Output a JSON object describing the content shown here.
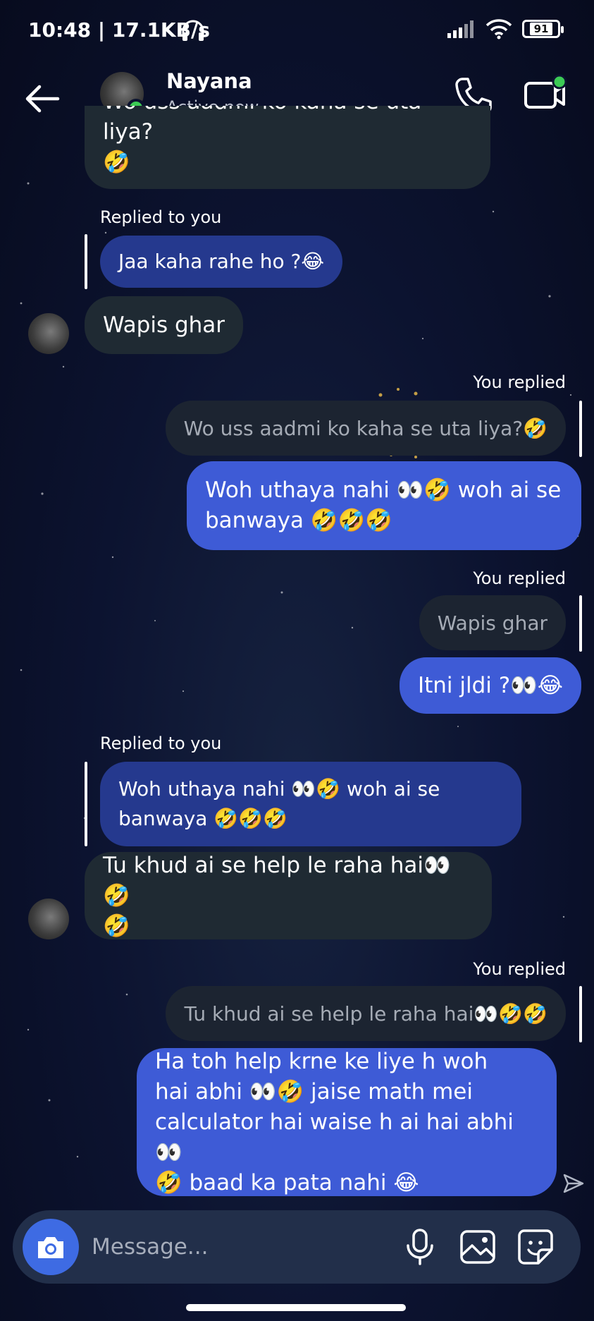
{
  "status_bar": {
    "time": "10:48 | 17.1KB/s",
    "battery": "91",
    "icons": [
      "headphones-icon",
      "signal-icon",
      "wifi-icon",
      "battery-icon"
    ]
  },
  "header": {
    "contact_name": "Nayana",
    "contact_status": "Active now",
    "online_color": "#3ccb55",
    "icons": [
      "back-arrow-icon",
      "phone-icon",
      "video-call-icon"
    ]
  },
  "messages": {
    "m0_line1": "Wo uss aadmi ko kaha se uta liya?",
    "m0_line2": "🤣",
    "m1_label": "Replied to you",
    "m1_quote": "Jaa kaha rahe ho ?😂",
    "m2_text": "Wapis ghar",
    "m3_label": "You replied",
    "m3_quote": "Wo uss aadmi ko kaha se uta liya?🤣",
    "m4_line1": "Woh uthaya nahi 👀🤣 woh ai se",
    "m4_line2": "banwaya 🤣🤣🤣",
    "m5_label": "You replied",
    "m5_quote": "Wapis ghar",
    "m6_text": "Itni jldi ?👀😂",
    "m7_label": "Replied to you",
    "m7_quote_line1": "Woh uthaya nahi 👀🤣 woh ai se",
    "m7_quote_line2": "banwaya 🤣🤣🤣",
    "m8_line1": "Tu khud ai se help le raha hai👀🤣",
    "m8_line2": "🤣",
    "m9_label": "You replied",
    "m9_quote": "Tu khud ai se help le raha hai👀🤣🤣",
    "m10_line1": "Ha toh help krne ke liye h woh",
    "m10_line2": "hai abhi 👀🤣 jaise math mei",
    "m10_line3": "calculator hai waise h ai hai abhi 👀",
    "m10_line4": "🤣 baad ka pata nahi 😂"
  },
  "composer": {
    "placeholder": "Message...",
    "accent": "#3e6be3",
    "icons": [
      "camera-icon",
      "microphone-icon",
      "gallery-icon",
      "sticker-icon"
    ]
  },
  "colors": {
    "incoming_bubble": "#1f2a33",
    "outgoing_bubble": "#3e5bd6",
    "quoted_incoming": "#25398e",
    "quoted_outgoing": "#1c2431",
    "background": "#0c1330"
  }
}
